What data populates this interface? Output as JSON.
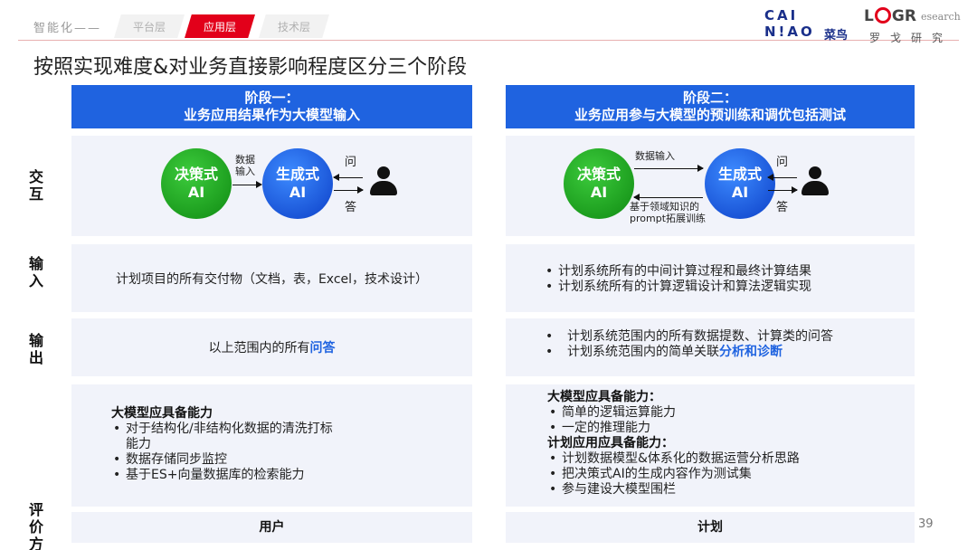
{
  "header": {
    "crumb_prefix": "智能化——",
    "tabs": [
      {
        "label": "平台层",
        "active": false
      },
      {
        "label": "应用层",
        "active": true
      },
      {
        "label": "技术层",
        "active": false
      }
    ],
    "logo_cainiao": {
      "line1": "CAI",
      "line2": "N!AO",
      "cn": "菜鸟"
    },
    "logo_logr": {
      "l": "L",
      "g": "G",
      "r": "R",
      "research": "esearch",
      "cn": "罗戈研究"
    }
  },
  "title": "按照实现难度&对业务直接影响程度区分三个阶段",
  "stages": [
    {
      "line1": "阶段一：",
      "line2": "业务应用结果作为大模型输入"
    },
    {
      "line1": "阶段二：",
      "line2": "业务应用参与大模型的预训练和调优包括测试"
    }
  ],
  "row_labels": {
    "interaction": [
      "交",
      "互"
    ],
    "input": [
      "输",
      "入"
    ],
    "output": [
      "输",
      "出"
    ],
    "evaluation": [
      "评",
      "价",
      "方"
    ]
  },
  "diagram": {
    "decision_ai": [
      "决策式",
      "AI"
    ],
    "generative_ai": [
      "生成式",
      "AI"
    ],
    "ask": "问",
    "answer": "答",
    "stage1_data_input": [
      "数据",
      "输入"
    ],
    "stage2_data_input": "数据输入",
    "stage2_prompt": [
      "基于领域知识的",
      "prompt拓展训练"
    ]
  },
  "input": {
    "stage1": "计划项目的所有交付物（文档，表，Excel，技术设计）",
    "stage2": [
      "计划系统所有的中间计算过程和最终计算结果",
      "计划系统所有的计算逻辑设计和算法逻辑实现"
    ]
  },
  "output": {
    "stage1_prefix": "以上范围内的所有",
    "stage1_highlight": "问答",
    "stage2_line1": "计划系统范围内的所有数据提数、计算类的问答",
    "stage2_line2_prefix": "计划系统范围内的简单关联",
    "stage2_line2_highlight": "分析和诊断"
  },
  "capability": {
    "stage1_heading": "大模型应具备能力",
    "stage1_items": [
      "对于结构化/非结构化数据的清洗打标能力",
      "数据存储同步监控",
      "基于ES+向量数据库的检索能力"
    ],
    "stage2_heading1": "大模型应具备能力：",
    "stage2_items1": [
      "简单的逻辑运算能力",
      "一定的推理能力"
    ],
    "stage2_heading2": "计划应用应具备能力：",
    "stage2_items2": [
      "计划数据模型&体系化的数据运营分析思路",
      "把决策式AI的生成内容作为测试集",
      "参与建设大模型围栏"
    ]
  },
  "evaluation": {
    "stage1": "用户",
    "stage2": "计划"
  },
  "page_number": "39",
  "colors": {
    "accent_red": "#e2001a",
    "stage_blue": "#1f63e0",
    "panel_bg": "#f1f3fa",
    "green_ai": "#13a016",
    "blue_ai": "#1752e0"
  }
}
